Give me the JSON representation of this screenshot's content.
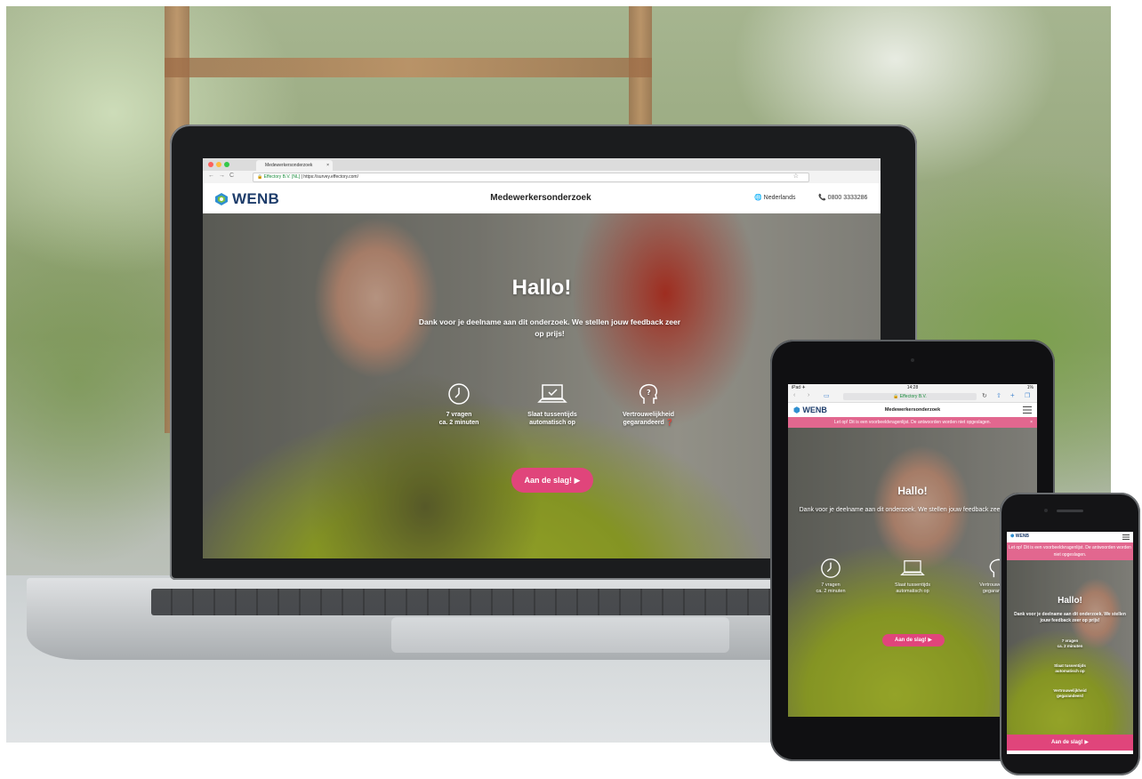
{
  "colors": {
    "brand": "#1e3d6b",
    "accent_pink": "#e0457b",
    "alert_pink": "#e2678f",
    "secure_green": "#1a8d3c"
  },
  "laptop": {
    "browser": {
      "tab_title": "Medewerkersonderzoek",
      "tab_close": "×",
      "url_secure_label": "Effectory B.V. [NL]",
      "url_text": "https://survey.effectory.com/"
    },
    "header": {
      "logo_text": "WENB",
      "page_title": "Medewerkersonderzoek",
      "language_label": "Nederlands",
      "phone_number": "0800 3333286"
    },
    "hero": {
      "title": "Hallo!",
      "text": "Dank voor je deelname aan dit onderzoek. We stellen jouw feedback zeer op prijs!",
      "features": [
        {
          "icon": "clock-icon",
          "line1": "7 vragen",
          "line2": "ca. 2 minuten"
        },
        {
          "icon": "laptop-icon",
          "line1": "Slaat tussentijds",
          "line2": "automatisch op"
        },
        {
          "icon": "head-question-icon",
          "line1": "Vertrouwelijkheid",
          "line2": "gegarandeerd"
        }
      ],
      "cta_label": "Aan de slag!"
    }
  },
  "tablet": {
    "status_left": "iPad ✈",
    "status_time": "14:28",
    "status_right": "1%",
    "url_text": "🔒 Effectory B.V.",
    "logo_text": "WENB",
    "page_title": "Medewerkersonderzoek",
    "alert_text": "Let op! Dit is een voorbeeldvragenlijst. De antwoorden worden niet opgeslagen.",
    "hero_title": "Hallo!",
    "hero_text": "Dank voor je deelname aan dit onderzoek. We stellen jouw feedback zeer op prijs!",
    "features": [
      {
        "line1": "7 vragen",
        "line2": "ca. 2 minuten"
      },
      {
        "line1": "Slaat tussentijds",
        "line2": "automatisch op"
      },
      {
        "line1": "Vertrouwelijkheid",
        "line2": "gegarandeerd"
      }
    ],
    "cta_label": "Aan de slag!"
  },
  "phone": {
    "logo_text": "WENB",
    "alert_text": "Let op! Dit is een voorbeeldvragenlijst. De antwoorden worden niet opgeslagen.",
    "hero_title": "Hallo!",
    "hero_text": "Dank voor je deelname aan dit onderzoek. We stellen jouw feedback zeer op prijs!",
    "features": [
      {
        "line1": "7 vragen",
        "line2": "ca. 2 minuten"
      },
      {
        "line1": "Slaat tussentijds",
        "line2": "automatisch op"
      },
      {
        "line1": "Vertrouwelijkheid",
        "line2": "gegarandeerd"
      }
    ],
    "cta_label": "Aan de slag!"
  }
}
